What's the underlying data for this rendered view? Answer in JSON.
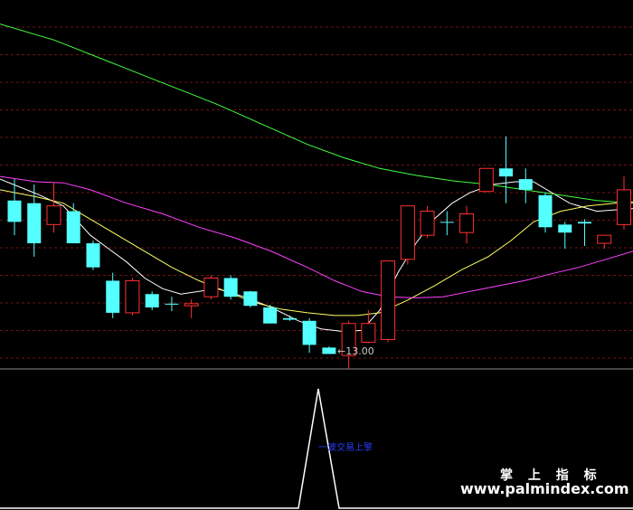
{
  "colors": {
    "background": "#000000",
    "grid": "#6e1414",
    "separator": "#8a8a8a",
    "candle_up": "#ff3030",
    "candle_down": "#54ffff",
    "ma_white": "#ffffff",
    "ma_yellow": "#ffff60",
    "ma_magenta": "#ff40ff",
    "ma_green": "#40ff40",
    "signal_line": "#ffffff",
    "signal_label": "#2a3cff"
  },
  "price_panel": {
    "low_marker_text": "←13.00"
  },
  "signal_panel": {
    "label": "一波交易上擎"
  },
  "watermark": {
    "line1": "掌 上 指 标",
    "line2": "www.palmindex.com"
  },
  "chart_data": {
    "type": "candlestick",
    "price_range": [
      12.5,
      19.4
    ],
    "low_price": 13.0,
    "candles": [
      {
        "open": 15.65,
        "high": 16.05,
        "low": 15.0,
        "close": 15.25
      },
      {
        "open": 15.6,
        "high": 15.95,
        "low": 14.6,
        "close": 14.85
      },
      {
        "open": 15.2,
        "high": 16.0,
        "low": 15.05,
        "close": 15.55
      },
      {
        "open": 15.45,
        "high": 15.6,
        "low": 14.85,
        "close": 14.85
      },
      {
        "open": 14.85,
        "high": 14.9,
        "low": 14.35,
        "close": 14.4
      },
      {
        "open": 14.15,
        "high": 14.3,
        "low": 13.45,
        "close": 13.55
      },
      {
        "open": 13.55,
        "high": 14.2,
        "low": 13.5,
        "close": 14.15
      },
      {
        "open": 13.9,
        "high": 13.95,
        "low": 13.6,
        "close": 13.65
      },
      {
        "open": 13.72,
        "high": 13.85,
        "low": 13.58,
        "close": 13.72
      },
      {
        "open": 13.68,
        "high": 13.8,
        "low": 13.45,
        "close": 13.72
      },
      {
        "open": 13.85,
        "high": 14.25,
        "low": 13.8,
        "close": 14.2
      },
      {
        "open": 14.2,
        "high": 14.25,
        "low": 13.8,
        "close": 13.85
      },
      {
        "open": 13.95,
        "high": 13.96,
        "low": 13.65,
        "close": 13.68
      },
      {
        "open": 13.65,
        "high": 13.7,
        "low": 13.4,
        "close": 13.35
      },
      {
        "open": 13.45,
        "high": 13.5,
        "low": 13.4,
        "close": 13.42
      },
      {
        "open": 13.4,
        "high": 13.45,
        "low": 12.8,
        "close": 12.95
      },
      {
        "open": 12.9,
        "high": 12.92,
        "low": 12.78,
        "close": 12.78
      },
      {
        "open": 12.75,
        "high": 13.4,
        "low": 12.5,
        "close": 13.35
      },
      {
        "open": 13.0,
        "high": 13.6,
        "low": 12.98,
        "close": 13.35
      },
      {
        "open": 13.05,
        "high": 14.5,
        "low": 13.0,
        "close": 14.52
      },
      {
        "open": 14.55,
        "high": 15.55,
        "low": 14.45,
        "close": 15.55
      },
      {
        "open": 15.0,
        "high": 15.55,
        "low": 14.95,
        "close": 15.45
      },
      {
        "open": 15.25,
        "high": 15.45,
        "low": 15.0,
        "close": 15.25
      },
      {
        "open": 15.05,
        "high": 15.55,
        "low": 14.85,
        "close": 15.4
      },
      {
        "open": 15.82,
        "high": 16.25,
        "low": 15.8,
        "close": 16.25
      },
      {
        "open": 16.25,
        "high": 16.85,
        "low": 15.6,
        "close": 16.1
      },
      {
        "open": 16.05,
        "high": 16.25,
        "low": 15.6,
        "close": 15.85
      },
      {
        "open": 15.75,
        "high": 15.8,
        "low": 15.05,
        "close": 15.15
      },
      {
        "open": 15.2,
        "high": 15.25,
        "low": 14.75,
        "close": 15.05
      },
      {
        "open": 15.25,
        "high": 15.3,
        "low": 14.8,
        "close": 15.22
      },
      {
        "open": 14.85,
        "high": 15.0,
        "low": 14.75,
        "close": 15.0
      },
      {
        "open": 15.2,
        "high": 16.1,
        "low": 15.1,
        "close": 15.85
      }
    ],
    "series": [
      {
        "color": "ma_white",
        "values": [
          [
            0,
            16.05
          ],
          [
            40,
            15.78
          ],
          [
            70,
            15.55
          ],
          [
            100,
            15.0
          ],
          [
            120,
            14.75
          ],
          [
            140,
            14.5
          ],
          [
            160,
            14.2
          ],
          [
            180,
            14.0
          ],
          [
            200,
            13.9
          ],
          [
            240,
            14.0
          ],
          [
            270,
            13.85
          ],
          [
            300,
            13.65
          ],
          [
            330,
            13.4
          ],
          [
            355,
            13.25
          ],
          [
            380,
            13.2
          ],
          [
            400,
            13.22
          ],
          [
            420,
            13.6
          ],
          [
            440,
            14.3
          ],
          [
            460,
            14.85
          ],
          [
            480,
            15.3
          ],
          [
            500,
            15.6
          ],
          [
            520,
            15.8
          ],
          [
            545,
            15.95
          ],
          [
            570,
            16.0
          ],
          [
            590,
            16.0
          ],
          [
            610,
            15.8
          ],
          [
            630,
            15.6
          ],
          [
            660,
            15.45
          ],
          [
            700,
            15.5
          ]
        ]
      },
      {
        "color": "ma_yellow",
        "values": [
          [
            0,
            15.85
          ],
          [
            40,
            15.72
          ],
          [
            70,
            15.6
          ],
          [
            100,
            15.3
          ],
          [
            130,
            15.0
          ],
          [
            160,
            14.7
          ],
          [
            190,
            14.4
          ],
          [
            220,
            14.15
          ],
          [
            250,
            13.95
          ],
          [
            280,
            13.75
          ],
          [
            310,
            13.62
          ],
          [
            340,
            13.55
          ],
          [
            370,
            13.5
          ],
          [
            395,
            13.5
          ],
          [
            420,
            13.55
          ],
          [
            450,
            13.78
          ],
          [
            480,
            14.05
          ],
          [
            510,
            14.35
          ],
          [
            540,
            14.6
          ],
          [
            565,
            14.9
          ],
          [
            590,
            15.25
          ],
          [
            620,
            15.45
          ],
          [
            650,
            15.55
          ],
          [
            680,
            15.6
          ],
          [
            700,
            15.62
          ]
        ]
      },
      {
        "color": "ma_magenta",
        "values": [
          [
            0,
            16.1
          ],
          [
            40,
            16.0
          ],
          [
            70,
            15.98
          ],
          [
            100,
            15.85
          ],
          [
            140,
            15.6
          ],
          [
            180,
            15.4
          ],
          [
            220,
            15.15
          ],
          [
            260,
            14.95
          ],
          [
            300,
            14.7
          ],
          [
            340,
            14.4
          ],
          [
            370,
            14.15
          ],
          [
            400,
            13.95
          ],
          [
            430,
            13.85
          ],
          [
            460,
            13.83
          ],
          [
            490,
            13.85
          ],
          [
            520,
            13.95
          ],
          [
            550,
            14.05
          ],
          [
            580,
            14.15
          ],
          [
            610,
            14.28
          ],
          [
            640,
            14.4
          ],
          [
            670,
            14.55
          ],
          [
            700,
            14.7
          ]
        ]
      },
      {
        "color": "ma_green",
        "values": [
          [
            0,
            18.95
          ],
          [
            60,
            18.65
          ],
          [
            120,
            18.25
          ],
          [
            180,
            17.85
          ],
          [
            240,
            17.45
          ],
          [
            300,
            17.0
          ],
          [
            340,
            16.7
          ],
          [
            380,
            16.45
          ],
          [
            420,
            16.25
          ],
          [
            460,
            16.12
          ],
          [
            500,
            16.02
          ],
          [
            540,
            15.95
          ],
          [
            580,
            15.85
          ],
          [
            620,
            15.75
          ],
          [
            660,
            15.65
          ],
          [
            700,
            15.6
          ]
        ]
      }
    ],
    "signal": {
      "type": "line",
      "x": [
        0,
        330,
        352,
        375,
        700
      ],
      "y": [
        0,
        0,
        1,
        0,
        0
      ]
    }
  }
}
